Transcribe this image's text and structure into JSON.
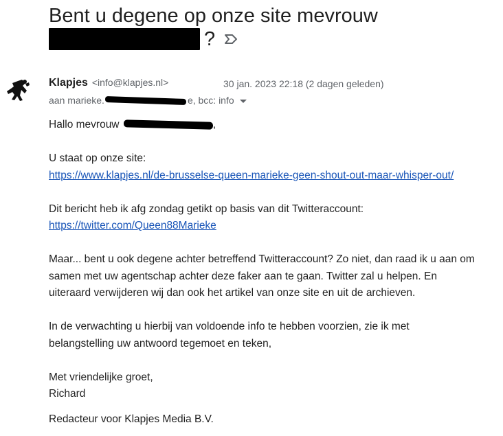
{
  "subject": {
    "line1": "Bent u degene op onze site mevrouw",
    "line2_suffix": "?"
  },
  "sender": {
    "name": "Klapjes",
    "email": "<info@klapjes.nl>",
    "date": "30 jan. 2023 22:18 (2 dagen geleden)"
  },
  "recipients": {
    "prefix": "aan marieke.",
    "suffix": "e, bcc: info"
  },
  "body": {
    "greeting_prefix": "Hallo mevrouw ",
    "greeting_suffix": ",",
    "site_intro": "U staat op onze site:",
    "site_link": "https://www.klapjes.nl/de-brusselse-queen-marieke-geen-shout-out-maar-whisper-out/",
    "twitter_intro": "Dit bericht heb ik afg zondag getikt op basis van dit Twitteraccount:",
    "twitter_link": "https://twitter.com/Queen88Marieke",
    "para1_l1": "Maar... bent u ook degene achter betreffend Twitteraccount? Zo niet, dan raad ik u aan om",
    "para1_l2": "samen met uw agentschap achter deze faker aan te gaan. Twitter zal u helpen. En",
    "para1_l3": "uiteraard verwijderen wij dan ook het artikel van onze site en uit de archieven.",
    "para2_l1": "In de verwachting u hierbij van voldoende info te hebben voorzien, zie ik met",
    "para2_l2": "belangstelling uw antwoord tegemoet en teken,",
    "closing": "Met vriendelijke groet,",
    "signature_name": "Richard",
    "signature_title": "Redacteur voor Klapjes Media B.V."
  },
  "icons": {
    "avatar": "klapjes-logo-icon",
    "label": "label-important-icon",
    "dropdown": "chevron-down-icon"
  }
}
